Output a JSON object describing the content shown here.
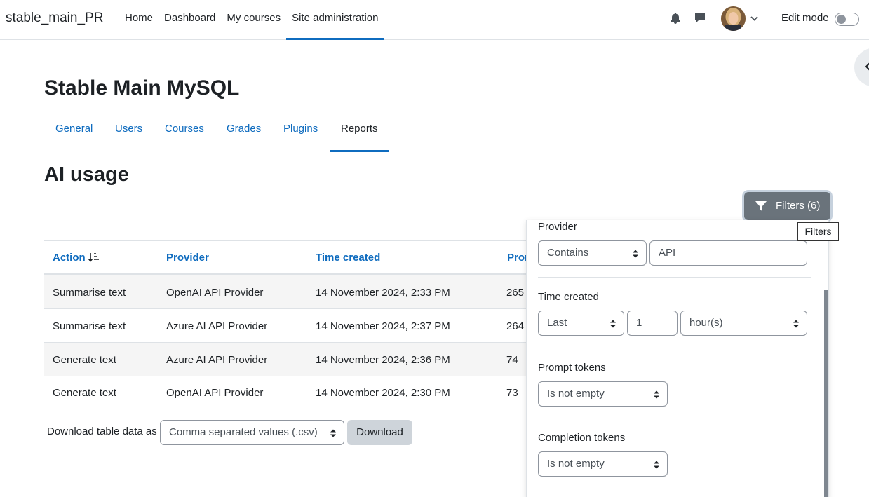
{
  "navbar": {
    "brand": "stable_main_PR",
    "items": [
      "Home",
      "Dashboard",
      "My courses",
      "Site administration"
    ],
    "edit_mode_label": "Edit mode"
  },
  "page": {
    "title": "Stable Main MySQL",
    "tabs": [
      "General",
      "Users",
      "Courses",
      "Grades",
      "Plugins",
      "Reports"
    ],
    "report_title": "AI usage"
  },
  "filters_button": {
    "label": "Filters (6)",
    "tooltip": "Filters"
  },
  "table": {
    "headers": [
      "Action",
      "Provider",
      "Time created",
      "Pron"
    ],
    "rows": [
      [
        "Summarise text",
        "OpenAI API Provider",
        "14 November 2024, 2:33 PM",
        "265"
      ],
      [
        "Summarise text",
        "Azure AI API Provider",
        "14 November 2024, 2:37 PM",
        "264"
      ],
      [
        "Generate text",
        "Azure AI API Provider",
        "14 November 2024, 2:36 PM",
        "74"
      ],
      [
        "Generate text",
        "OpenAI API Provider",
        "14 November 2024, 2:30 PM",
        "73"
      ]
    ]
  },
  "download": {
    "label": "Download table data as",
    "format": "Comma separated values (.csv)",
    "button": "Download"
  },
  "filters_panel": {
    "provider": {
      "label": "Provider",
      "operator": "Contains",
      "value": "API"
    },
    "time_created": {
      "label": "Time created",
      "operator": "Last",
      "amount": "1",
      "unit": "hour(s)"
    },
    "prompt_tokens": {
      "label": "Prompt tokens",
      "operator": "Is not empty"
    },
    "completion_tokens": {
      "label": "Completion tokens",
      "operator": "Is not empty"
    }
  },
  "colors": {
    "link": "#0f6cbf",
    "active_underline": "#0f6cbf",
    "filters_button": "#6a737b"
  },
  "icons": [
    "bell-icon",
    "chat-icon",
    "chevron-down-icon",
    "chevron-left-icon",
    "filter-icon",
    "sort-icon",
    "select-caret-icon"
  ]
}
